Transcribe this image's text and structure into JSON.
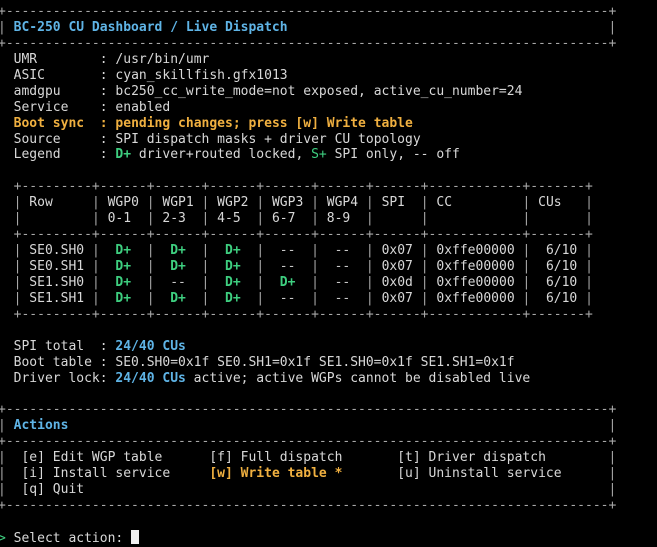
{
  "window": {
    "title": "BC-250 CU Dashboard / Live Dispatch"
  },
  "info": {
    "umr_key": "UMR",
    "umr_val": "/usr/bin/umr",
    "asic_key": "ASIC",
    "asic_val": "cyan_skillfish.gfx1013",
    "amdgpu_key": "amdgpu",
    "amdgpu_val": "bc250_cc_write_mode=not exposed, active_cu_number=24",
    "service_key": "Service",
    "service_val": "enabled",
    "bootsync_key": "Boot sync",
    "bootsync_val": "pending changes; press [w] Write table",
    "source_key": "Source",
    "source_val": "SPI dispatch masks + driver CU topology",
    "legend_key": "Legend",
    "legend_dplus": "D+",
    "legend_dplus_desc": " driver+routed locked, ",
    "legend_splus": "S+",
    "legend_splus_desc": " SPI only, -- off"
  },
  "table": {
    "headers": [
      "Row",
      "WGP0",
      "WGP1",
      "WGP2",
      "WGP3",
      "WGP4",
      "SPI",
      "CC",
      "CUs"
    ],
    "subheaders": [
      "",
      "0-1",
      "2-3",
      "4-5",
      "6-7",
      "8-9",
      "",
      "",
      ""
    ],
    "rows": [
      {
        "row": "SE0.SH0",
        "w": [
          "D+",
          "D+",
          "D+",
          "--",
          "--"
        ],
        "spi": "0x07",
        "cc": "0xffe00000",
        "cus": "6/10"
      },
      {
        "row": "SE0.SH1",
        "w": [
          "D+",
          "D+",
          "D+",
          "--",
          "--"
        ],
        "spi": "0x07",
        "cc": "0xffe00000",
        "cus": "6/10"
      },
      {
        "row": "SE1.SH0",
        "w": [
          "D+",
          "--",
          "D+",
          "D+",
          "--"
        ],
        "spi": "0x0d",
        "cc": "0xffe00000",
        "cus": "6/10"
      },
      {
        "row": "SE1.SH1",
        "w": [
          "D+",
          "D+",
          "D+",
          "--",
          "--"
        ],
        "spi": "0x07",
        "cc": "0xffe00000",
        "cus": "6/10"
      }
    ]
  },
  "summary": {
    "spi_key": "SPI total  : ",
    "spi_val": "24/40 CUs",
    "boot_key": "Boot table : ",
    "boot_val": "SE0.SH0=0x1f SE0.SH1=0x1f SE1.SH0=0x1f SE1.SH1=0x1f",
    "drv_key": "Driver lock: ",
    "drv_val": "24/40 CUs",
    "drv_suffix": " active; active WGPs cannot be disabled live"
  },
  "actions": {
    "title": "Actions",
    "items": [
      {
        "key": "[e]",
        "label": "Edit WGP table"
      },
      {
        "key": "[f]",
        "label": "Full dispatch"
      },
      {
        "key": "[t]",
        "label": "Driver dispatch"
      },
      {
        "key": "[i]",
        "label": "Install service"
      },
      {
        "key": "[w]",
        "label": "Write table *"
      },
      {
        "key": "[u]",
        "label": "Uninstall service"
      },
      {
        "key": "[q]",
        "label": "Quit"
      }
    ]
  },
  "prompt": {
    "arrow": ">",
    "text": " Select action: "
  },
  "colors": {
    "background": "#000000",
    "title": "#5fb4e6",
    "warning": "#f0b040",
    "driver_locked": "#3ecf80",
    "value_highlight": "#5fb4e6"
  }
}
